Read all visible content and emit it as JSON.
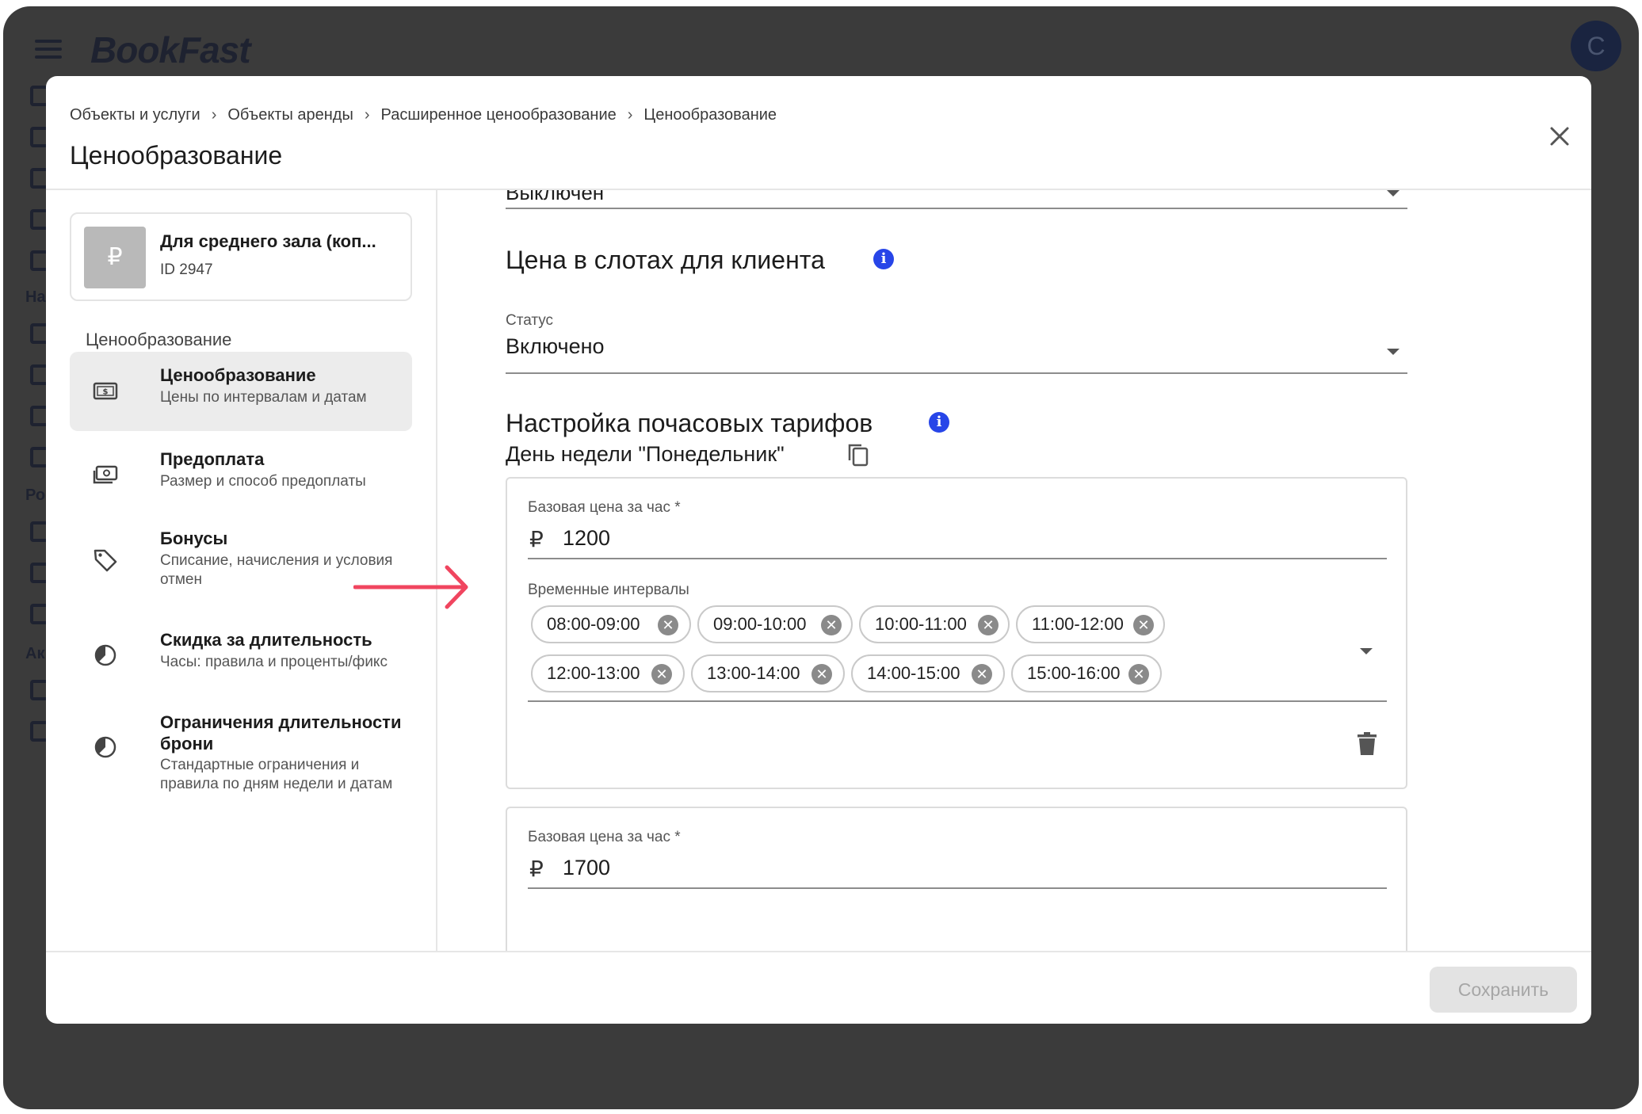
{
  "app": {
    "logo": "BookFast",
    "avatar_letter": "C",
    "sidebar_partial_labels": [
      "На",
      "Ро",
      "Ак"
    ]
  },
  "modal": {
    "breadcrumb": [
      "Объекты и услуги",
      "Объекты аренды",
      "Расширенное ценообразование",
      "Ценообразование"
    ],
    "title": "Ценообразование"
  },
  "object_card": {
    "thumb_symbol": "₽",
    "title": "Для среднего зала (коп...",
    "id_label": "ID 2947"
  },
  "nav": {
    "heading": "Ценообразование",
    "items": [
      {
        "title": "Ценообразование",
        "desc": "Цены по интервалам и датам",
        "icon": "money-icon"
      },
      {
        "title": "Предоплата",
        "desc": "Размер и способ предоплаты",
        "icon": "cash-icon"
      },
      {
        "title": "Бонусы",
        "desc": "Списание, начисления и условия отмен",
        "icon": "tag-icon"
      },
      {
        "title": "Скидка за длительность",
        "desc": "Часы: правила и проценты/фикс",
        "icon": "timer-icon"
      },
      {
        "title": "Ограничения длительности брони",
        "desc": "Стандартные ограничения и правила по дням недели и датам",
        "icon": "timer-icon"
      }
    ]
  },
  "content": {
    "prev_select_value": "Выключен",
    "slot_price": {
      "title": "Цена в слотах для клиента",
      "status_label": "Статус",
      "status_value": "Включено"
    },
    "hourly": {
      "title": "Настройка почасовых тарифов",
      "day_title": "День недели \"Понедельник\"",
      "currency_symbol": "₽",
      "tariffs": [
        {
          "price_label": "Базовая цена за час *",
          "price": "1200",
          "intervals_label": "Временные интервалы",
          "intervals": [
            "08:00-09:00",
            "09:00-10:00",
            "10:00-11:00",
            "11:00-12:00",
            "12:00-13:00",
            "13:00-14:00",
            "14:00-15:00",
            "15:00-16:00"
          ]
        },
        {
          "price_label": "Базовая цена за час *",
          "price": "1700"
        }
      ]
    }
  },
  "footer": {
    "save_label": "Сохранить"
  },
  "colors": {
    "accent_info": "#2745e8",
    "annotation_arrow": "#f0455f",
    "backdrop": "#3b3b3b"
  }
}
